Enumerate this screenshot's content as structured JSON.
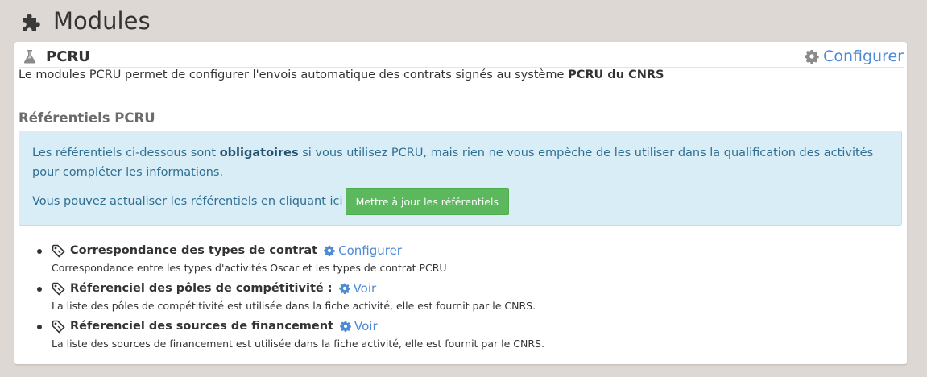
{
  "page": {
    "title": "Modules"
  },
  "module": {
    "name": "PCRU",
    "configure_label": "Configurer",
    "description_prefix": "Le modules PCRU permet de configurer l'envois automatique des contrats signés au système ",
    "description_bold": "PCRU du CNRS"
  },
  "referentiels": {
    "section_title": "Référentiels PCRU",
    "alert": {
      "text_before": "Les référentiels ci-dessous sont ",
      "text_bold": "obligatoires",
      "text_after": " si vous utilisez PCRU, mais rien ne vous empèche de les utiliser dans la qualification des activités pour compléter les informations.",
      "update_text": "Vous pouvez actualiser les référentiels en cliquant ici",
      "update_button": "Mettre à jour les référentiels"
    },
    "items": [
      {
        "title": "Correspondance des types de contrat",
        "link": "Configurer",
        "subtitle": "Correspondance entre les types d'activités Oscar et les types de contrat PCRU"
      },
      {
        "title": "Réferenciel des pôles de compétitivité :",
        "link": "Voir",
        "subtitle": "La liste des pôles de compétitivité est utilisée dans la fiche activité, elle est fournit par le CNRS."
      },
      {
        "title": "Réferenciel des sources de financement",
        "link": "Voir",
        "subtitle": "La liste des sources de financement est utilisée dans la fiche activité, elle est fournit par le CNRS."
      }
    ]
  },
  "colors": {
    "link": "#4f8ad6",
    "alert_bg": "#d9edf6",
    "alert_text": "#2f6f93",
    "button": "#5cb85c",
    "background": "#ddd8d3"
  },
  "icons": {
    "header": "puzzle-icon",
    "module": "flask-icon",
    "configure": "gear-icon",
    "item": "tag-icon"
  }
}
